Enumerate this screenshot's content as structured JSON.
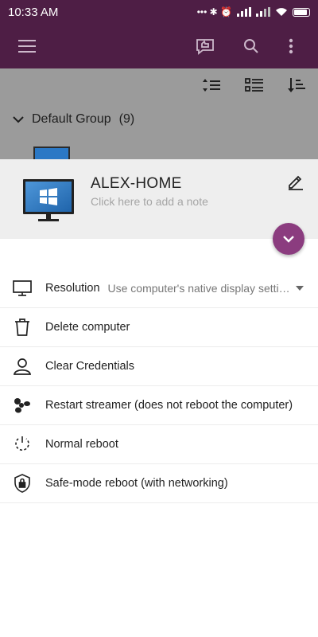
{
  "status_bar": {
    "time": "10:33 AM",
    "indicators": "••• ✱ ⏰"
  },
  "app_bar": {
    "icons": [
      "menu-icon",
      "feedback-icon",
      "search-icon",
      "more-vert-icon"
    ]
  },
  "toolbar": {
    "icons": [
      "sort-order-icon",
      "view-list-icon",
      "sort-alpha-icon"
    ]
  },
  "group": {
    "label": "Default Group",
    "count": "(9)"
  },
  "computer": {
    "name": "ALEX-HOME",
    "note_placeholder": "Click here to add a note"
  },
  "menu": {
    "resolution_label": "Resolution",
    "resolution_value": "Use computer's native display settings",
    "delete_label": "Delete computer",
    "clear_label": "Clear Credentials",
    "restart_label": "Restart streamer (does not reboot the computer)",
    "reboot_label": "Normal reboot",
    "safe_reboot_label": "Safe-mode reboot (with networking)"
  },
  "colors": {
    "app_bar": "#4e1e45",
    "fab": "#8b3c7f",
    "windows_blue": "#2b78c5"
  }
}
